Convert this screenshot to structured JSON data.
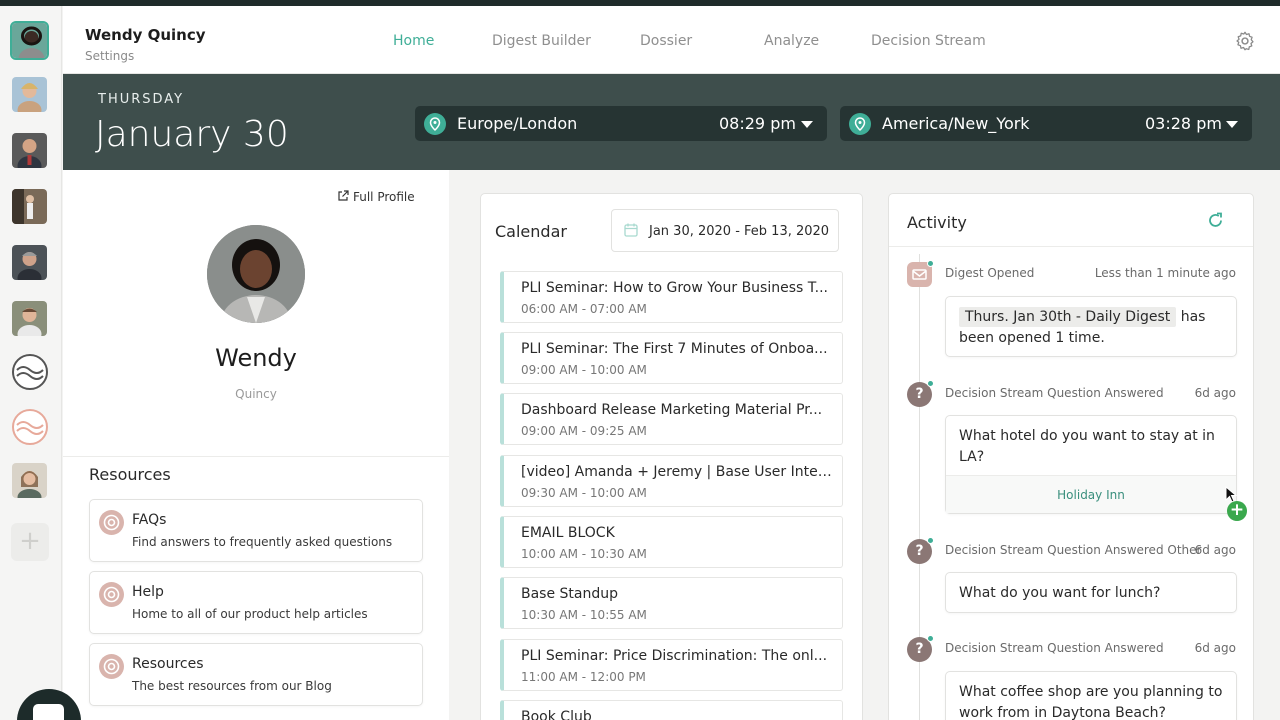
{
  "user": {
    "name": "Wendy Quincy",
    "settings_label": "Settings"
  },
  "nav": {
    "home": "Home",
    "digest_builder": "Digest Builder",
    "dossier": "Dossier",
    "analyze": "Analyze",
    "decision_stream": "Decision Stream"
  },
  "banner": {
    "day": "THURSDAY",
    "date": "January 30",
    "timezones": [
      {
        "zone": "Europe/London",
        "time": "08:29 pm"
      },
      {
        "zone": "America/New_York",
        "time": "03:28 pm"
      }
    ]
  },
  "profile": {
    "full_profile_link": "Full Profile",
    "first_name": "Wendy",
    "last_name": "Quincy"
  },
  "resources": {
    "title": "Resources",
    "items": [
      {
        "title": "FAQs",
        "desc": "Find answers to frequently asked questions"
      },
      {
        "title": "Help",
        "desc": "Home to all of our product help articles"
      },
      {
        "title": "Resources",
        "desc": "The best resources from our Blog"
      }
    ]
  },
  "calendar": {
    "title": "Calendar",
    "range": "Jan 30, 2020 - Feb 13, 2020",
    "events": [
      {
        "title": "PLI Seminar: How to Grow Your Business T...",
        "time": "06:00 AM - 07:00 AM"
      },
      {
        "title": "PLI Seminar: The First 7 Minutes of Onboa...",
        "time": "09:00 AM - 10:00 AM"
      },
      {
        "title": "Dashboard Release Marketing Material Pr...",
        "time": "09:00 AM - 09:25 AM"
      },
      {
        "title": "[video] Amanda + Jeremy | Base User Inter...",
        "time": "09:30 AM - 10:00 AM"
      },
      {
        "title": "EMAIL BLOCK",
        "time": "10:00 AM - 10:30 AM"
      },
      {
        "title": "Base Standup",
        "time": "10:30 AM - 10:55 AM"
      },
      {
        "title": "PLI Seminar: Price Discrimination: The onl...",
        "time": "11:00 AM - 12:00 PM"
      },
      {
        "title": "Book Club",
        "time": ""
      }
    ]
  },
  "activity": {
    "title": "Activity",
    "items": [
      {
        "label": "Digest Opened",
        "time": "Less than 1 minute ago",
        "tag": "Thurs. Jan 30th - Daily Digest",
        "text": "has been opened 1 time."
      },
      {
        "label": "Decision Stream Question Answered",
        "time": "6d ago",
        "text": "What hotel do you want to stay at in LA?",
        "answer": "Holiday Inn"
      },
      {
        "label": "Decision Stream Question Answered Other",
        "time": "6d ago",
        "text": "What do you want for lunch?"
      },
      {
        "label": "Decision Stream Question Answered",
        "time": "6d ago",
        "text": "What coffee shop are you planning to work from in Daytona Beach?"
      }
    ]
  },
  "colors": {
    "accent": "#3fae97",
    "banner": "#3e4e4c",
    "tz_pill": "#263433"
  }
}
